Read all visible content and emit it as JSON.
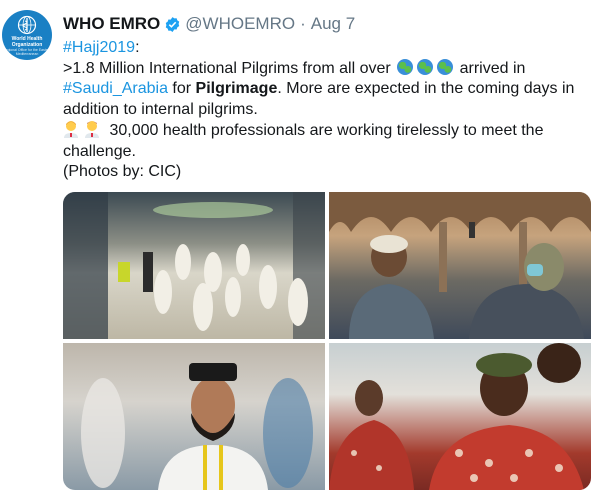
{
  "account": {
    "name": "WHO EMRO",
    "handle": "@WHOEMRO",
    "date": "Aug 7",
    "avatar_org": "World Health Organization",
    "avatar_sub": "Regional Office for the Eastern Mediterranean"
  },
  "tweet": {
    "hashtag_hajj": "#Hajj2019",
    "hashtag_hajj_suffix": ":",
    "line2_prefix": ">1.8 Million International Pilgrims from all over",
    "line2_suffix": "arrived in",
    "hashtag_saudi": "#Saudi_Arabia",
    "for_text": " for ",
    "pilgrimage": "Pilgrimage",
    "more_text": ". More are expected in the coming days in addition to internal pilgrims.",
    "health_text": "30,000 health professionals are working tirelessly to meet the challenge.",
    "photos_credit": "(Photos by: CIC)"
  },
  "icons": {
    "verified": "verified-badge",
    "globes": [
      "globe-europe-africa",
      "globe-americas",
      "globe-asia-australia"
    ],
    "workers": [
      "woman-health-worker",
      "man-health-worker"
    ]
  },
  "colors": {
    "link": "#1b95e0",
    "muted": "#657786",
    "text": "#14171a",
    "who_blue": "#1a80c4"
  }
}
